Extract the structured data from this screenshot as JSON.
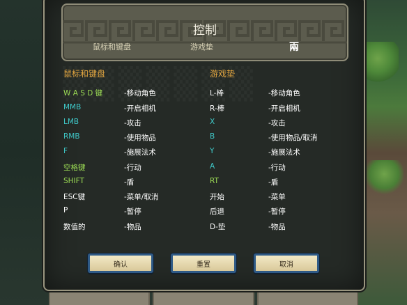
{
  "header": {
    "title": "控制",
    "tabs": [
      {
        "label": "鼠标和键盘"
      },
      {
        "label": "游戏垫"
      },
      {
        "label": "兩"
      }
    ]
  },
  "columns": {
    "left_heading": "鼠标和键盘",
    "right_heading": "游戏垫"
  },
  "keyboard_rows": [
    {
      "key": "W A S D 键",
      "action": "-移动角色"
    },
    {
      "key": "MMB",
      "action": "-开启相机"
    },
    {
      "key": "LMB",
      "action": "-攻击"
    },
    {
      "key": "RMB",
      "action": "-使用物品"
    },
    {
      "key": "F",
      "action": "-施展法术"
    },
    {
      "key": "空格键",
      "action": "-行动"
    },
    {
      "key": "SHIFT",
      "action": "-盾"
    },
    {
      "key": "ESC键",
      "action": "-菜单/取消"
    },
    {
      "key": "P",
      "action": "-暂停"
    },
    {
      "key": "数值的",
      "action": "-物品"
    }
  ],
  "gamepad_rows": [
    {
      "key": "L-棒",
      "action": "-移动角色"
    },
    {
      "key": "R-棒",
      "action": "-开启相机"
    },
    {
      "key": "X",
      "action": "-攻击"
    },
    {
      "key": "B",
      "action": "-使用物品/取消"
    },
    {
      "key": "Y",
      "action": "-施展法术"
    },
    {
      "key": "A",
      "action": "-行动"
    },
    {
      "key": "RT",
      "action": "-盾"
    },
    {
      "key": "开始",
      "action": "-菜单"
    },
    {
      "key": "后退",
      "action": "-暂停"
    },
    {
      "key": "D-垫",
      "action": "-物品"
    }
  ],
  "buttons": {
    "confirm": "确认",
    "reset": "重置",
    "cancel": "取消"
  },
  "colors": {
    "heading": "#e3a640",
    "key_green": "#9cdc55",
    "key_teal": "#3fc8c8",
    "button_border": "#2f5a86"
  },
  "icons": [
    "meander-pattern"
  ]
}
